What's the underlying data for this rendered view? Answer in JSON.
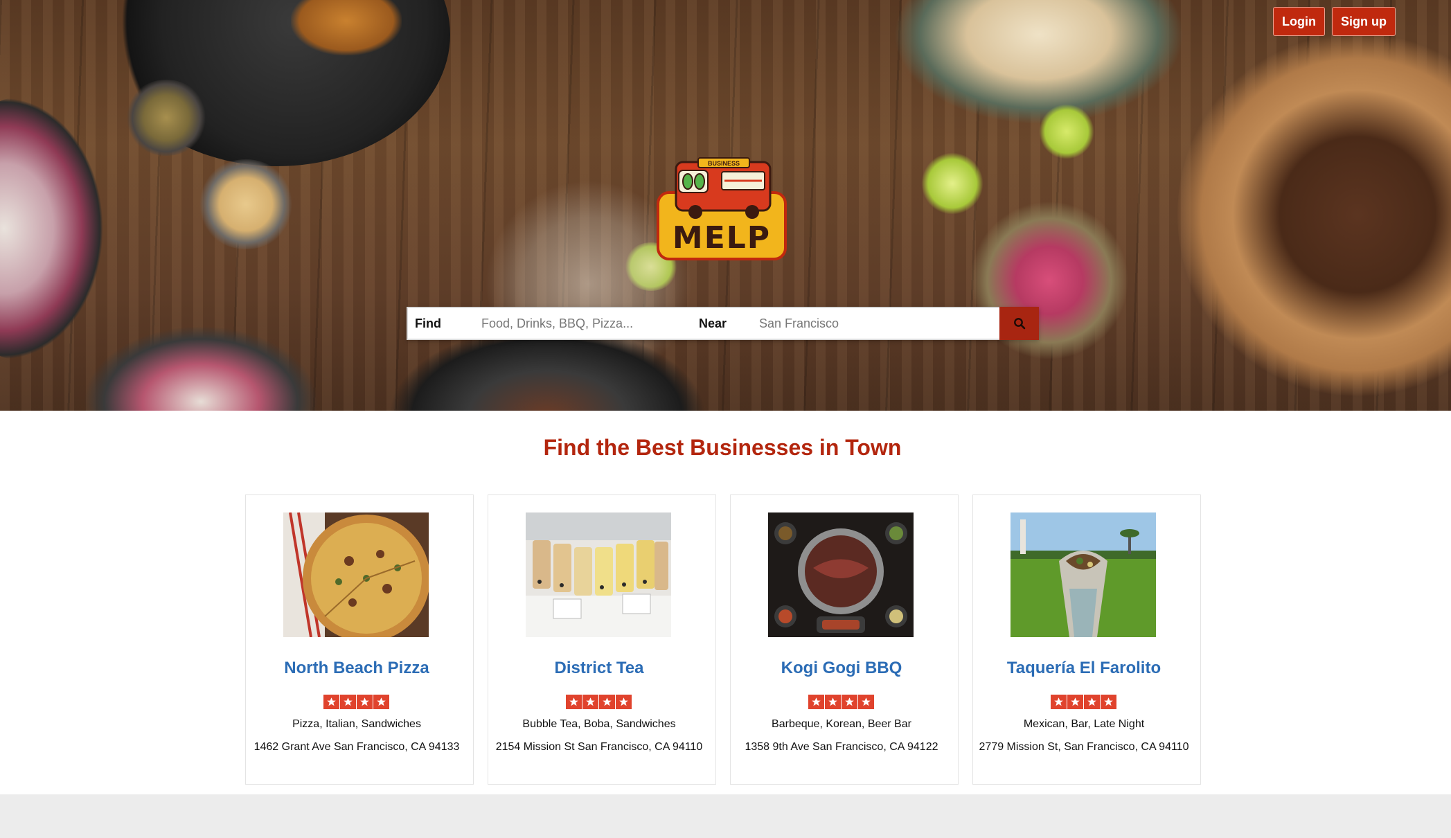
{
  "header": {
    "login_label": "Login",
    "signup_label": "Sign up"
  },
  "logo": {
    "badge_text": "BUSINESS",
    "wordmark": "MELP"
  },
  "search": {
    "find_label": "Find",
    "find_placeholder": "Food, Drinks, BBQ, Pizza...",
    "near_label": "Near",
    "near_placeholder": "San Francisco",
    "button_icon": "search-icon"
  },
  "main": {
    "title": "Find the Best Businesses in Town"
  },
  "businesses": [
    {
      "name": "North Beach Pizza",
      "rating": 4,
      "categories": "Pizza, Italian, Sandwiches",
      "address": "1462 Grant Ave San Francisco, CA 94133"
    },
    {
      "name": "District Tea",
      "rating": 4,
      "categories": "Bubble Tea, Boba, Sandwiches",
      "address": "2154 Mission St San Francisco, CA 94110"
    },
    {
      "name": "Kogi Gogi BBQ",
      "rating": 4,
      "categories": "Barbeque, Korean, Beer Bar",
      "address": "1358 9th Ave San Francisco, CA 94122"
    },
    {
      "name": "Taquería El Farolito",
      "rating": 4,
      "categories": "Mexican, Bar, Late Night",
      "address": "2779 Mission St, San Francisco, CA 94110"
    }
  ],
  "colors": {
    "brand_red": "#c0290e",
    "title_red": "#b3260e",
    "link_blue": "#2b6cb5",
    "star_red": "#e0432d",
    "footer_gray": "#ececec"
  }
}
